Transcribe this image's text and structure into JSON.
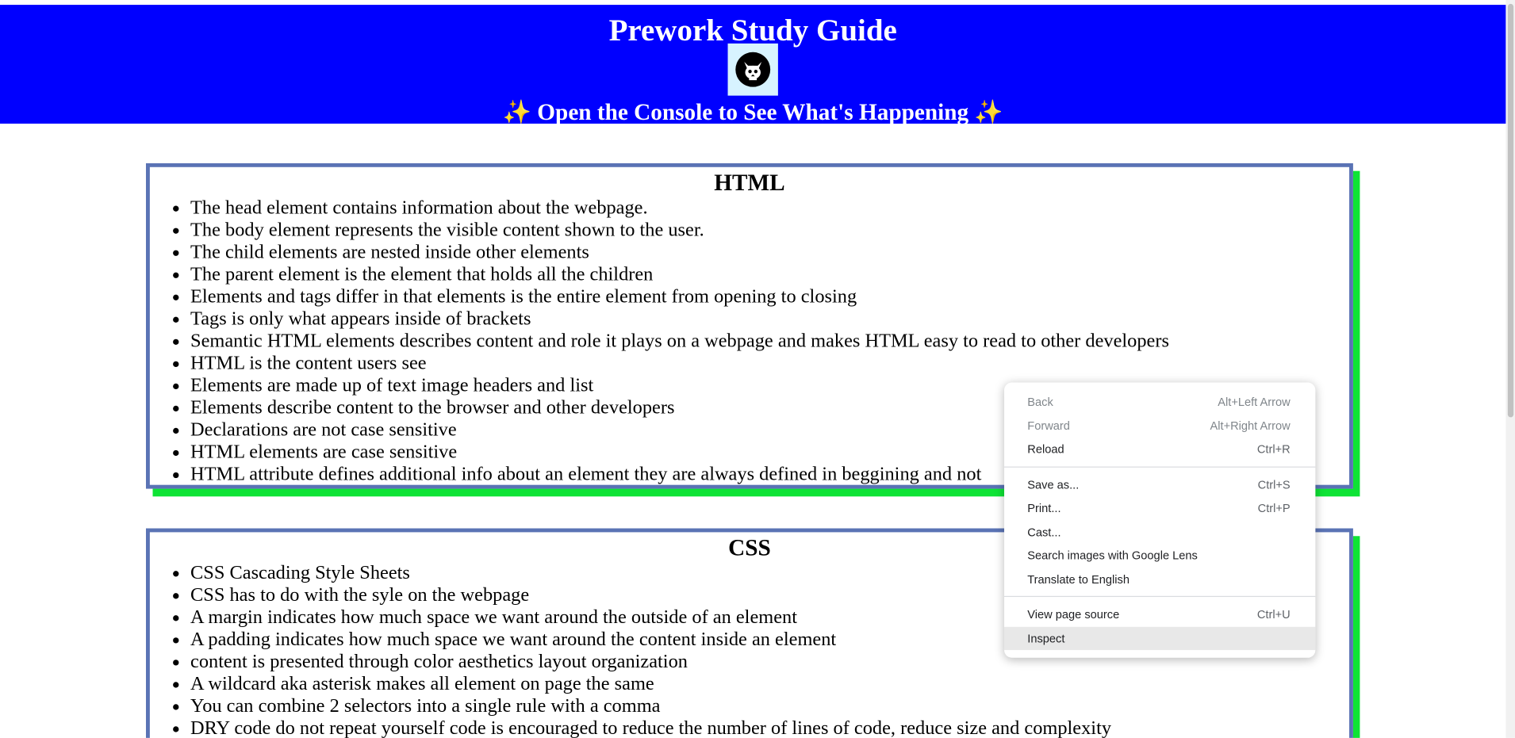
{
  "header": {
    "title": "Prework Study Guide",
    "subtitle": "✨ Open the Console to See What's Happening ✨",
    "colors": {
      "background": "#0000ff",
      "text": "#ffffff"
    },
    "logo_icon": "cat-skull-icon"
  },
  "sections": {
    "html": {
      "title": "HTML",
      "items": [
        "The head element contains information about the webpage.",
        "The body element represents the visible content shown to the user.",
        "The child elements are nested inside other elements",
        "The parent element is the element that holds all the children",
        "Elements and tags differ in that elements is the entire element from opening to closing",
        "Tags is only what appears inside of brackets",
        "Semantic HTML elements describes content and role it plays on a webpage and makes HTML easy to read to other developers",
        "HTML is the content users see",
        "Elements are made up of text image headers and list",
        "Elements describe content to the browser and other developers",
        "Declarations are not case sensitive",
        "HTML elements are case sensitive",
        "HTML attribute defines additional info about an element they are always defined in beggining and not"
      ]
    },
    "css": {
      "title": "CSS",
      "items": [
        "CSS Cascading Style Sheets",
        "CSS has to do with the syle on the webpage",
        "A margin indicates how much space we want around the outside of an element",
        "A padding indicates how much space we want around the content inside an element",
        "content is presented through color aesthetics layout organization",
        "A wildcard aka asterisk makes all element on page the same",
        "You can combine 2 selectors into a single rule with a comma",
        "DRY code do not repeat yourself code is encouraged to reduce the number of lines of code, reduce size and complexity"
      ]
    },
    "colors": {
      "border": "#5a73b5",
      "shadow": "#0ee335"
    }
  },
  "context_menu": {
    "back": {
      "label": "Back",
      "shortcut": "Alt+Left Arrow"
    },
    "forward": {
      "label": "Forward",
      "shortcut": "Alt+Right Arrow"
    },
    "reload": {
      "label": "Reload",
      "shortcut": "Ctrl+R"
    },
    "save_as": {
      "label": "Save as...",
      "shortcut": "Ctrl+S"
    },
    "print": {
      "label": "Print...",
      "shortcut": "Ctrl+P"
    },
    "cast": {
      "label": "Cast..."
    },
    "google_lens": {
      "label": "Search images with Google Lens"
    },
    "translate": {
      "label": "Translate to English"
    },
    "view_source": {
      "label": "View page source",
      "shortcut": "Ctrl+U"
    },
    "inspect": {
      "label": "Inspect"
    }
  }
}
